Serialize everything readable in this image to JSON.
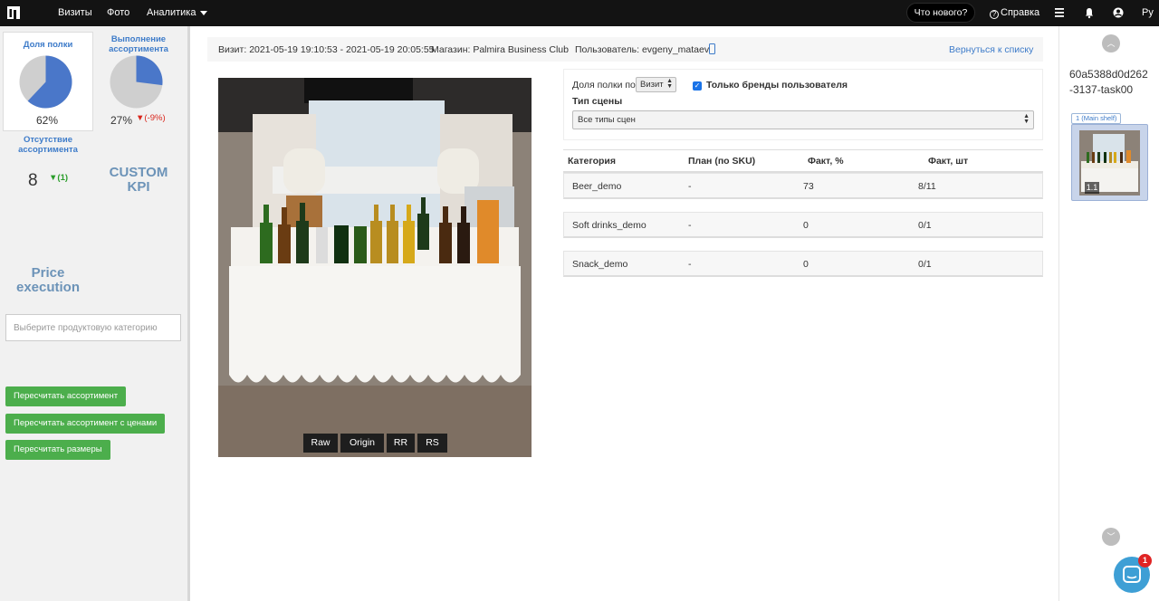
{
  "topbar": {
    "nav": [
      "Визиты",
      "Фото",
      "Аналитика"
    ],
    "whats_new": "Что нового?",
    "help": "Справка",
    "lang": "Ру",
    "icons": [
      "logo-icon",
      "menu-icon",
      "bell-icon",
      "user-icon"
    ]
  },
  "sidebar": {
    "shelf_share": {
      "title": "Доля полки",
      "value": "62%",
      "fraction": 0.62
    },
    "assortment": {
      "title": "Выполнение ассортимента",
      "value": "27%",
      "delta": "▼(-9%)",
      "fraction": 0.27
    },
    "absence": {
      "title": "Отсутствие ассортимента",
      "value": "8",
      "delta": "▼(1)"
    },
    "custom_kpi": "CUSTOM KPI",
    "price_execution": "Price execution",
    "category_placeholder": "Выберите продуктовую категорию",
    "buttons": [
      "Пересчитать ассортимент",
      "Пересчитать ассортимент с ценами",
      "Пересчитать размеры"
    ],
    "colors": {
      "pie_fill": "#4a77c9",
      "pie_rest": "#cfcfcf",
      "green": "#4cae4c"
    }
  },
  "visit": {
    "time": "Визит: 2021-05-19 19:10:53 - 2021-05-19 20:05:55",
    "store": "Магазин: Palmira Business Club",
    "user": "Пользователь: evgeny_mataev",
    "back": "Вернуться к списку"
  },
  "photo": {
    "buttons": [
      "Raw",
      "Origin",
      "RR",
      "RS"
    ]
  },
  "filters": {
    "shelf_share_by": "Доля полки по",
    "shelf_share_value": "Визит",
    "only_brands": "Только бренды пользователя",
    "scene_type_label": "Тип сцены",
    "scene_type_value": "Все типы сцен"
  },
  "table": {
    "headers": [
      "Категория",
      "План (по SKU)",
      "Факт, %",
      "Факт, шт"
    ],
    "rows": [
      {
        "category": "Beer_demo",
        "plan": "-",
        "fact_pct": "73",
        "fact_pcs": "8/11"
      },
      {
        "category": "Soft drinks_demo",
        "plan": "-",
        "fact_pct": "0",
        "fact_pcs": "0/1"
      },
      {
        "category": "Snack_demo",
        "plan": "-",
        "fact_pct": "0",
        "fact_pcs": "0/1"
      }
    ]
  },
  "right": {
    "task_id": "60a5388d0d262-3137-task00",
    "shelf_tag": "1 (Main shelf)",
    "thumb_label": "1.1",
    "chat_badge": "1"
  }
}
